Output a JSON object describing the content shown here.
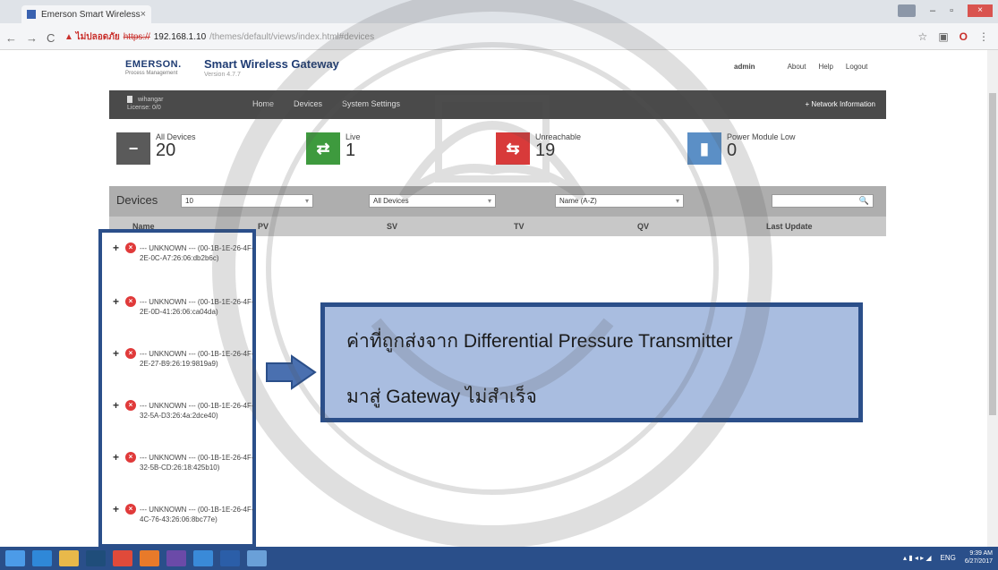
{
  "browser": {
    "tab_title": "Emerson Smart Wireless",
    "tab_close": "×",
    "url_warning": "▲ ไม่ปลอดภัย",
    "url_scheme": "https://",
    "url_host": "192.168.1.10",
    "url_path": "/themes/default/views/index.html#devices",
    "back": "←",
    "forward": "→",
    "reload": "C",
    "star": "☆",
    "menu": "⋮"
  },
  "app": {
    "brand": "EMERSON.",
    "brand_sub": "Process Management",
    "title": "Smart Wireless Gateway",
    "version": "Version 4.7.7",
    "user": "admin",
    "links": [
      "About",
      "Help",
      "Logout"
    ]
  },
  "nav": {
    "user_line1": "wihangar",
    "user_line2": "License: 0/0",
    "links": [
      "Home",
      "Devices",
      "System Settings"
    ],
    "network_info": "+ Network Information"
  },
  "tiles": [
    {
      "label": "All Devices",
      "count": "20",
      "color": "#5a5a5a",
      "icon": "minus-icon",
      "glyph": "−"
    },
    {
      "label": "Live",
      "count": "1",
      "color": "#3e9a3e",
      "icon": "swap-arrows-icon",
      "glyph": "⇄"
    },
    {
      "label": "Unreachable",
      "count": "19",
      "color": "#d83a3a",
      "icon": "broken-link-icon",
      "glyph": "⇆"
    },
    {
      "label": "Power Module Low",
      "count": "0",
      "color": "#5b8fc6",
      "icon": "battery-icon",
      "glyph": "▮"
    }
  ],
  "devices": {
    "title": "Devices",
    "page_size": "10",
    "filter": "All Devices",
    "sort": "Name (A-Z)",
    "search_placeholder": ""
  },
  "columns": [
    "Name",
    "PV",
    "SV",
    "TV",
    "QV",
    "Last Update"
  ],
  "device_rows": [
    "--- UNKNOWN --- (00-1B-1E-26-4F-2E-0C-A7:26:06:db2b6c)",
    "--- UNKNOWN --- (00-1B-1E-26-4F-2E-0D-41:26:06:ca04da)",
    "--- UNKNOWN --- (00-1B-1E-26-4F-2E-27-B9:26:19:9819a9)",
    "--- UNKNOWN --- (00-1B-1E-26-4F-32-5A-D3:26:4a:2dce40)",
    "--- UNKNOWN --- (00-1B-1E-26-4F-32-5B-CD:26:18:425b10)",
    "--- UNKNOWN --- (00-1B-1E-26-4F-4C-76-43:26:06:8bc77e)"
  ],
  "callout": {
    "line1": "ค่าที่ถูกส่งจาก Differential Pressure Transmitter",
    "line2": "มาสู่ Gateway ไม่สำเร็จ"
  },
  "taskbar": {
    "lang": "ENG",
    "time": "9:39 AM",
    "date": "6/27/2017"
  },
  "colors": {
    "frame_blue": "#2b4f8a",
    "callout_fill": "#a9bde0",
    "error_red": "#e03a3a"
  }
}
